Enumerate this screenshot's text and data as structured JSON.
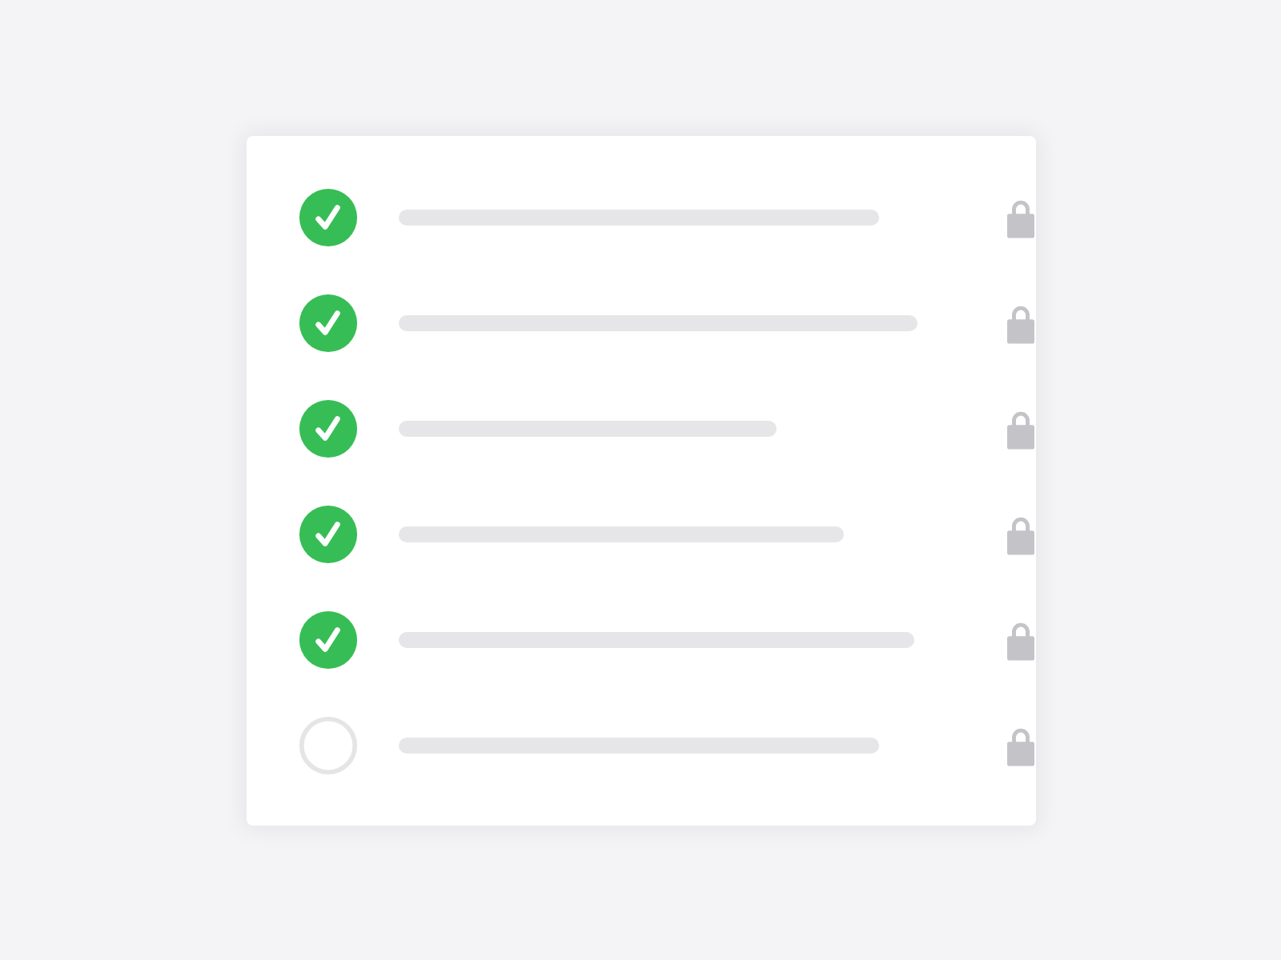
{
  "tasks": [
    {
      "checked": true,
      "locked": true
    },
    {
      "checked": true,
      "locked": true
    },
    {
      "checked": true,
      "locked": true
    },
    {
      "checked": true,
      "locked": true
    },
    {
      "checked": true,
      "locked": true
    },
    {
      "checked": false,
      "locked": true
    }
  ]
}
